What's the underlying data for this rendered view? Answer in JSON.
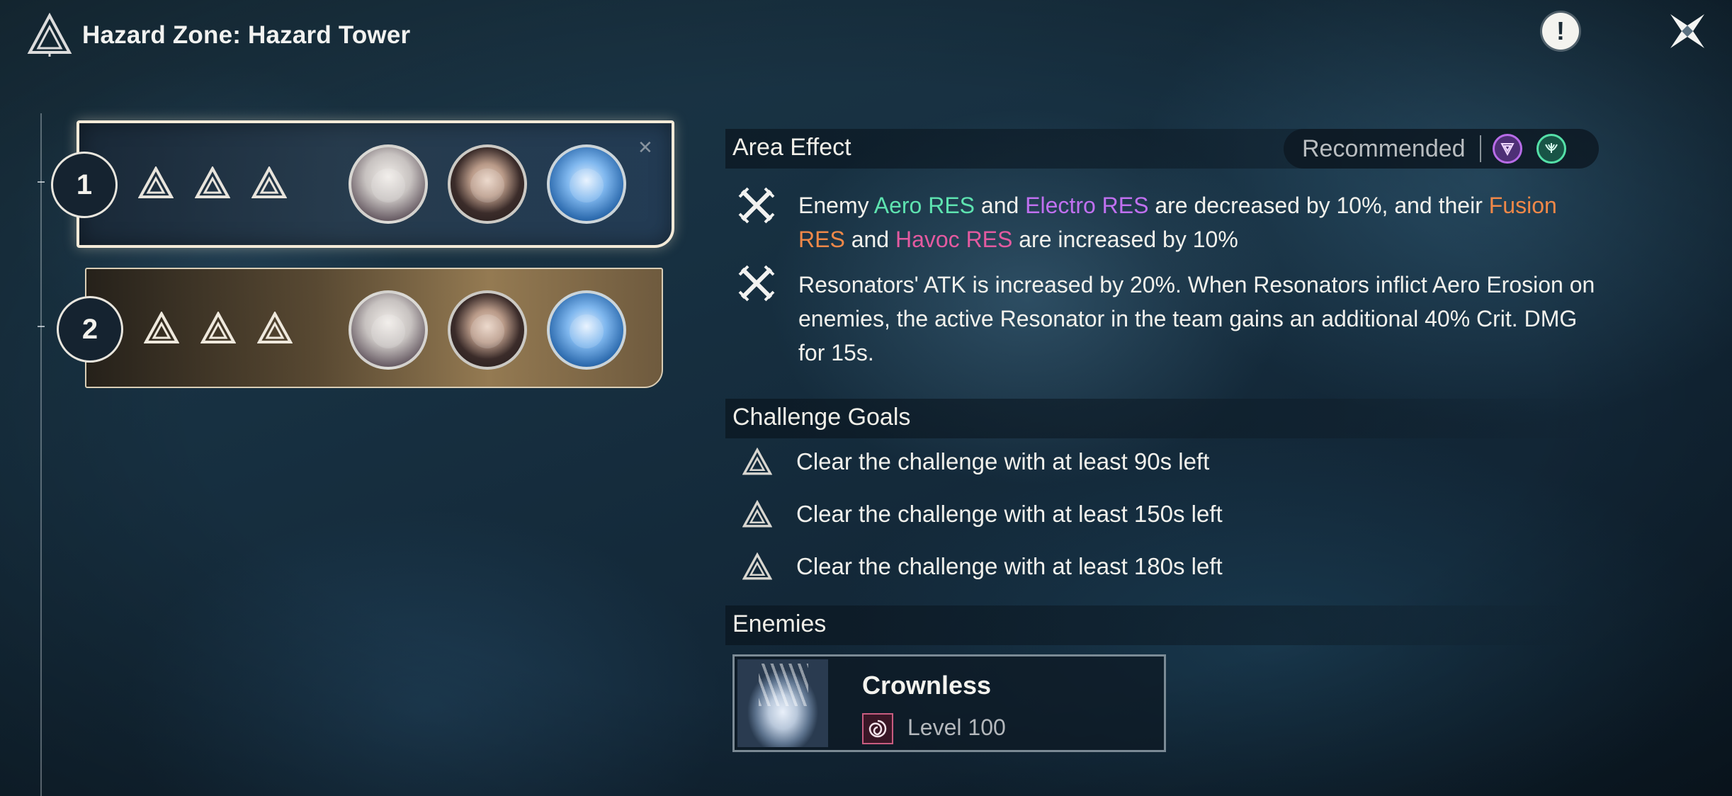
{
  "header": {
    "title": "Hazard Zone: Hazard Tower"
  },
  "stages": [
    {
      "number": "1",
      "stars": 3,
      "selected": true
    },
    {
      "number": "2",
      "stars": 3,
      "selected": false
    }
  ],
  "area_effect": {
    "title": "Area Effect",
    "recommended_label": "Recommended",
    "recommended_elements": [
      "electro-icon",
      "aero-icon"
    ],
    "effect1": {
      "p1": "Enemy ",
      "aero_res": "Aero RES",
      "p2": " and ",
      "electro_res": "Electro RES",
      "p3": " are decreased by 10%, and their ",
      "fusion_res": "Fusion RES",
      "p4": " and ",
      "havoc_res": "Havoc RES",
      "p5": " are increased by 10%"
    },
    "effect2": "Resonators' ATK is increased by 20%. When Resonators inflict Aero Erosion on enemies, the active Resonator in the team gains an additional 40% Crit. DMG for 15s."
  },
  "challenge_goals": {
    "title": "Challenge Goals",
    "items": [
      "Clear the challenge with at least 90s left",
      "Clear the challenge with at least 150s left",
      "Clear the challenge with at least 180s left"
    ]
  },
  "enemies": {
    "title": "Enemies",
    "list": [
      {
        "name": "Crownless",
        "level": "Level 100"
      }
    ]
  },
  "colors": {
    "aero": "#5ee3b0",
    "electro": "#c070f0",
    "fusion": "#f08848",
    "havoc": "#e45aa0"
  }
}
